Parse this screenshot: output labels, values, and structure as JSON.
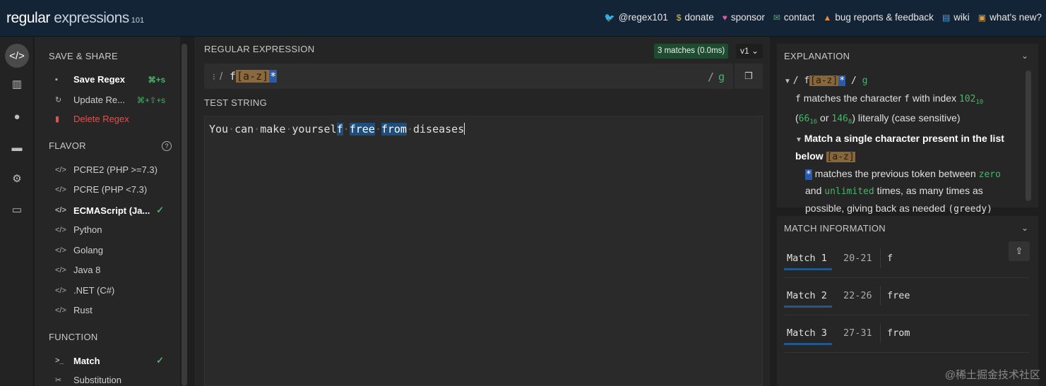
{
  "logo": {
    "bold": "regular",
    "light": " expressions",
    "small": "101"
  },
  "toplinks": [
    {
      "icon": "twitter-icon",
      "glyph": "🐦",
      "label": "@regex101",
      "color": "#4aa3df"
    },
    {
      "icon": "dollar-icon",
      "glyph": "$",
      "label": "donate",
      "color": "#e5c14a"
    },
    {
      "icon": "heart-icon",
      "glyph": "♥",
      "label": "sponsor",
      "color": "#e05ba1"
    },
    {
      "icon": "mail-icon",
      "glyph": "✉",
      "label": "contact",
      "color": "#49b36c"
    },
    {
      "icon": "warning-icon",
      "glyph": "▲",
      "label": "bug reports & feedback",
      "color": "#e28b3b"
    },
    {
      "icon": "book-icon",
      "glyph": "▤",
      "label": "wiki",
      "color": "#4aa3df"
    },
    {
      "icon": "gift-icon",
      "glyph": "▣",
      "label": "what's new?",
      "color": "#d9a04a"
    }
  ],
  "left": {
    "save_share_title": "SAVE & SHARE",
    "save": {
      "label": "Save Regex",
      "shortcut": "⌘+s"
    },
    "update": {
      "label": "Update Re...",
      "shortcut": "⌘+⇧+s"
    },
    "delete": {
      "label": "Delete Regex"
    },
    "flavor_title": "FLAVOR",
    "flavors": [
      {
        "label": "PCRE2 (PHP >=7.3)",
        "selected": false
      },
      {
        "label": "PCRE (PHP <7.3)",
        "selected": false
      },
      {
        "label": "ECMAScript (Ja...",
        "selected": true
      },
      {
        "label": "Python",
        "selected": false
      },
      {
        "label": "Golang",
        "selected": false
      },
      {
        "label": "Java 8",
        "selected": false
      },
      {
        "label": ".NET (C#)",
        "selected": false
      },
      {
        "label": "Rust",
        "selected": false
      }
    ],
    "function_title": "FUNCTION",
    "functions": [
      {
        "label": "Match",
        "selected": true,
        "glyph": ">_"
      },
      {
        "label": "Substitution",
        "selected": false,
        "glyph": "✂"
      }
    ]
  },
  "regex": {
    "title": "REGULAR EXPRESSION",
    "matches_badge": "3 matches (0.0ms)",
    "version": "v1 ⌄",
    "open_delim": "/",
    "pattern_literal": "f",
    "pattern_class": "[a-z]",
    "pattern_quant": "*",
    "close_delim": "/",
    "flags": "g"
  },
  "test": {
    "title": "TEST STRING",
    "segments": [
      {
        "t": "You",
        "m": false
      },
      {
        "t": "·",
        "dot": true
      },
      {
        "t": "can",
        "m": false
      },
      {
        "t": "·",
        "dot": true
      },
      {
        "t": "make",
        "m": false
      },
      {
        "t": "·",
        "dot": true
      },
      {
        "t": "yoursel",
        "m": false
      },
      {
        "t": "f",
        "m": true
      },
      {
        "t": "·",
        "dot": true
      },
      {
        "t": "free",
        "m": true
      },
      {
        "t": "·",
        "dot": true
      },
      {
        "t": "from",
        "m": true
      },
      {
        "t": "·",
        "dot": true
      },
      {
        "t": "diseases",
        "m": false
      }
    ]
  },
  "explanation": {
    "title": "EXPLANATION",
    "root_open": "/ ",
    "root_literal": "f",
    "root_class": "[a-z]",
    "root_quant": "*",
    "root_close": " / ",
    "root_flag": "g",
    "l1_code": "f",
    "l1_a": " matches the character ",
    "l1_b": "f",
    "l1_c": " with index ",
    "l1_idx": "102",
    "l1_idx_sub": "10",
    "l2_a": "66",
    "l2_a_sub": "16",
    "l2_or": " or ",
    "l2_b": "146",
    "l2_b_sub": "8",
    "l2_tail": ") literally (case sensitive)",
    "l2_head": "(",
    "class_head": "Match a single character present in the list below ",
    "class_code": "[a-z]",
    "quant_code": "*",
    "quant_a": " matches the previous token between ",
    "quant_zero": "zero",
    "quant_and": "and ",
    "quant_unl": "unlimited",
    "quant_b": " times, as many times as possible, giving back as needed ",
    "quant_greedy": "(greedy)"
  },
  "match_info": {
    "title": "MATCH INFORMATION",
    "rows": [
      {
        "label": "Match 1",
        "range": "20-21",
        "value": "f"
      },
      {
        "label": "Match 2",
        "range": "22-26",
        "value": "free"
      },
      {
        "label": "Match 3",
        "range": "27-31",
        "value": "from"
      }
    ]
  },
  "watermark": "@稀土掘金技术社区"
}
